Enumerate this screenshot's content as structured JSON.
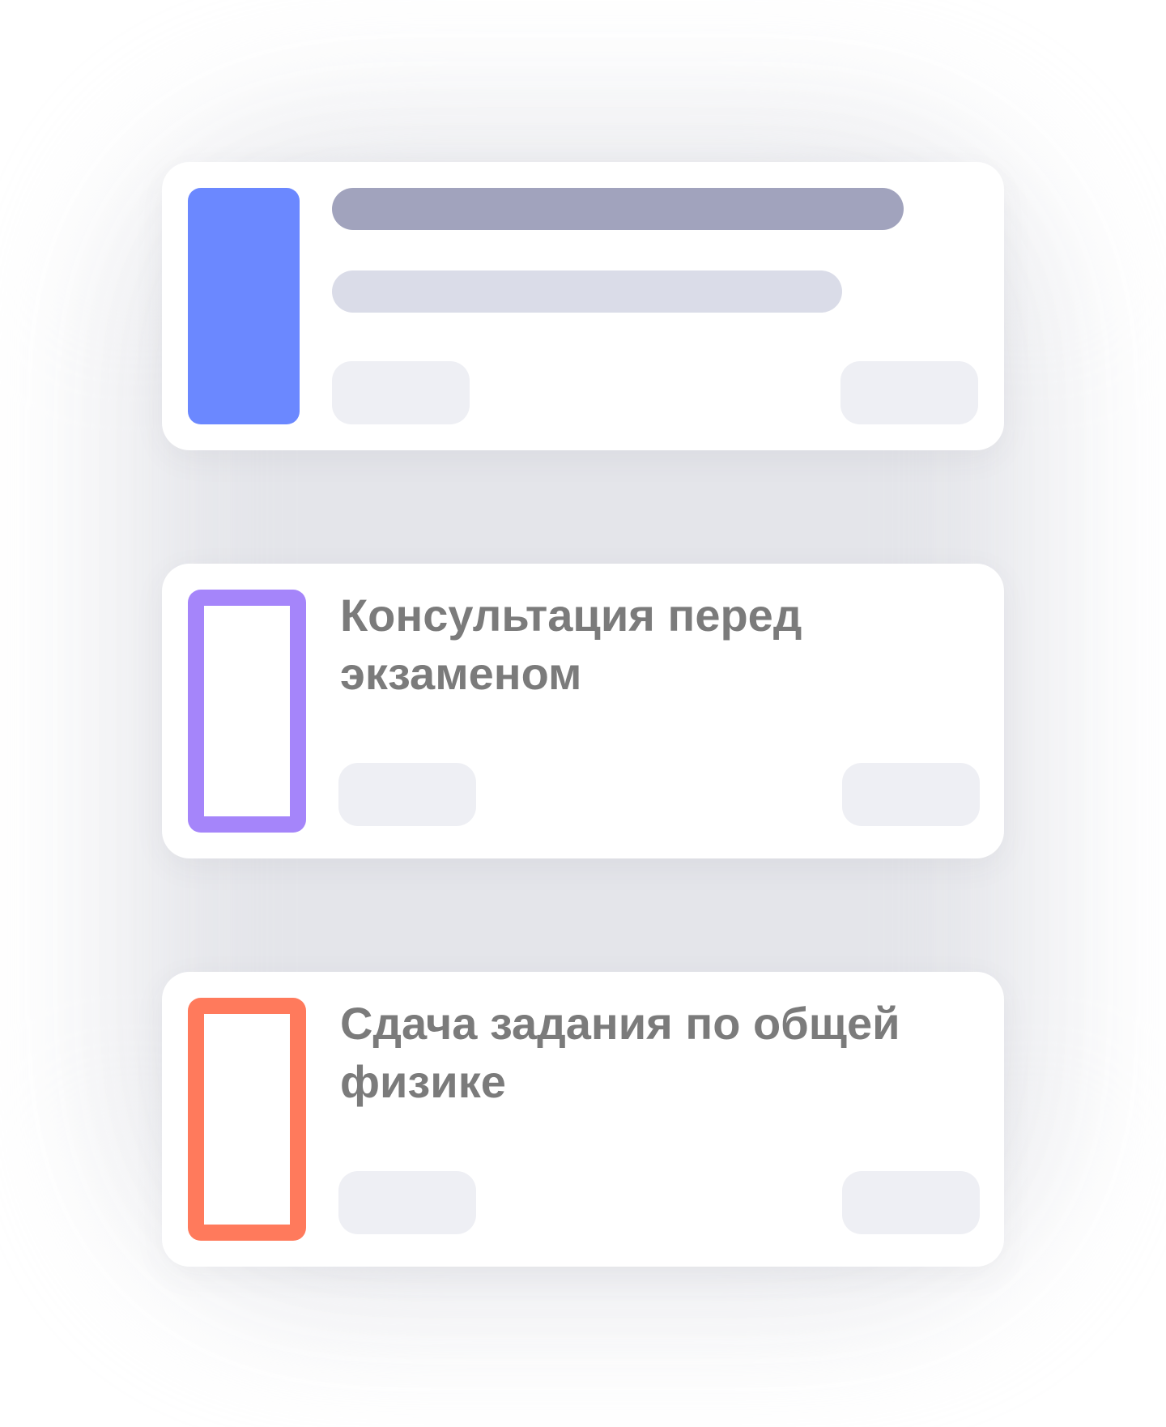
{
  "cards": [
    {
      "kind": "placeholder",
      "accent_color": "#6b88ff",
      "style": "filled"
    },
    {
      "kind": "event",
      "title": "Консультация перед экзаменом",
      "accent_color": "#a585fa",
      "style": "outline"
    },
    {
      "kind": "event",
      "title": "Сдача задания по общей физике",
      "accent_color": "#ff7a5c",
      "style": "outline"
    }
  ],
  "colors": {
    "title_text": "#7b7b7b",
    "skeleton_dark": "#a1a3bd",
    "skeleton_light": "#dadce8",
    "chip": "#eeeff4",
    "card_background": "#ffffff",
    "backdrop_glow": "#e3e4e9"
  }
}
